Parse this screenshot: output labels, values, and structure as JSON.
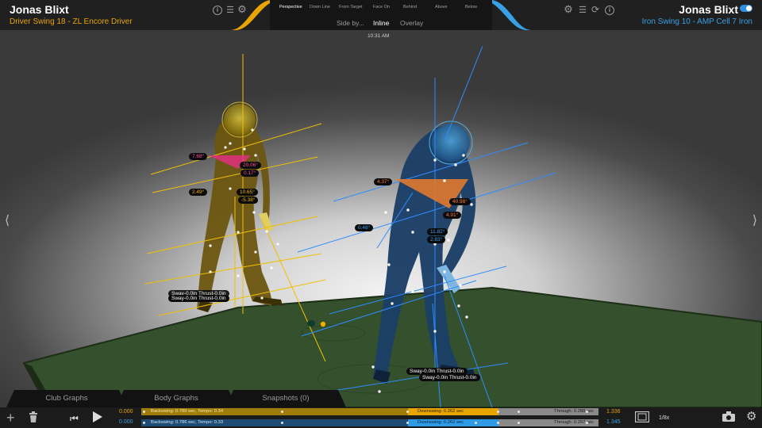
{
  "header": {
    "left": {
      "golfer": "Jonas Blixt",
      "swing": "Driver Swing 18 - ZL Encore Driver",
      "icons": [
        "info-icon",
        "list-icon",
        "gear-icon"
      ]
    },
    "right": {
      "golfer": "Jonas Blixt",
      "swing": "Iron Swing 10 - AMP Cell 7 Iron",
      "icons": [
        "gear-icon",
        "list-icon",
        "refresh-icon",
        "info-icon"
      ],
      "toggle_on": true
    },
    "views": [
      "Perspective",
      "Down Line",
      "From Target",
      "Face On",
      "Behind",
      "Above",
      "Below"
    ],
    "active_view": "Perspective",
    "modes": [
      "Side by...",
      "Inline",
      "Overlay"
    ],
    "active_mode": "Inline",
    "clock": "10:31 AM"
  },
  "annotations": {
    "left": [
      "7.68°",
      "20.06°",
      "0.17°",
      "2.49°",
      "10.65°",
      "-5.38°"
    ],
    "left_sway": "Sway-0.0in Thrust-0.0in",
    "left_sway_overlap": "Sway-0.0in Thrust-0.0in",
    "right": [
      "4.37°",
      "40.98°",
      "4.91°",
      "0.48°",
      "11.82°",
      "2.83°"
    ],
    "right_sway_1": "Sway-0.0in Thrust-0.0in",
    "right_sway_2": "Sway-0.0in Thrust-0.0in"
  },
  "tabs": [
    "Club Graphs",
    "Body Graphs",
    "Snapshots (0)"
  ],
  "timeline": {
    "top": {
      "start": "0.000",
      "end": "1.336",
      "backswing": "Backswing: 0.780 sec, Tempo: 0.34",
      "downswing": "Downswing: 0.262 sec",
      "through": "Through: 0.288 sec"
    },
    "bottom": {
      "start": "0.000",
      "end": "1.345",
      "backswing": "Backswing: 0.786 sec, Tempo: 0.33",
      "downswing": "Downswing: 0.262 sec",
      "through": "Through: 0.297 sec"
    },
    "playback_speed": "1/8x"
  },
  "colors": {
    "left_accent": "#e8a400",
    "right_accent": "#3aa0e6",
    "mat": "#3a5a30",
    "body_left": "#6b5510",
    "body_right": "#1c3f66"
  }
}
